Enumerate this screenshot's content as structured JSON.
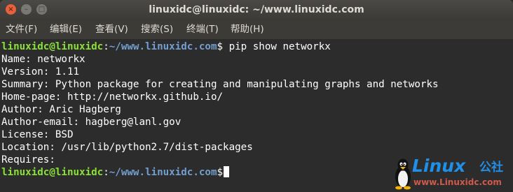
{
  "window": {
    "title": "linuxidc@linuxidc: ~/www.linuxidc.com",
    "controls": {
      "close": "×",
      "minimize": "–",
      "maximize": "□"
    }
  },
  "menu": [
    "文件(F)",
    "编辑(E)",
    "查看(V)",
    "搜索(S)",
    "终端(T)",
    "帮助(H)"
  ],
  "terminal": {
    "prompt_user": "linuxidc@linuxidc",
    "prompt_sep": ":",
    "prompt_path": "~/www.linuxidc.com",
    "prompt_symbol": "$",
    "command": " pip show networkx",
    "output": [
      "Name: networkx",
      "Version: 1.11",
      "Summary: Python package for creating and manipulating graphs and networks",
      "Home-page: http://networkx.github.io/",
      "Author: Aric Hagberg",
      "Author-email: hagberg@lanl.gov",
      "License: BSD",
      "Location: /usr/lib/python2.7/dist-packages",
      "Requires:"
    ]
  },
  "watermark": {
    "brand": "Linux",
    "brand_cn": "公社",
    "url": "www.Linuxidc.com"
  },
  "colors": {
    "background": "#2c2c2c",
    "prompt_user": "#8ae234",
    "prompt_path": "#729fcf",
    "close_button": "#e8603c",
    "logo_blue": "#1f8fe8",
    "logo_red": "#d05a4a"
  }
}
